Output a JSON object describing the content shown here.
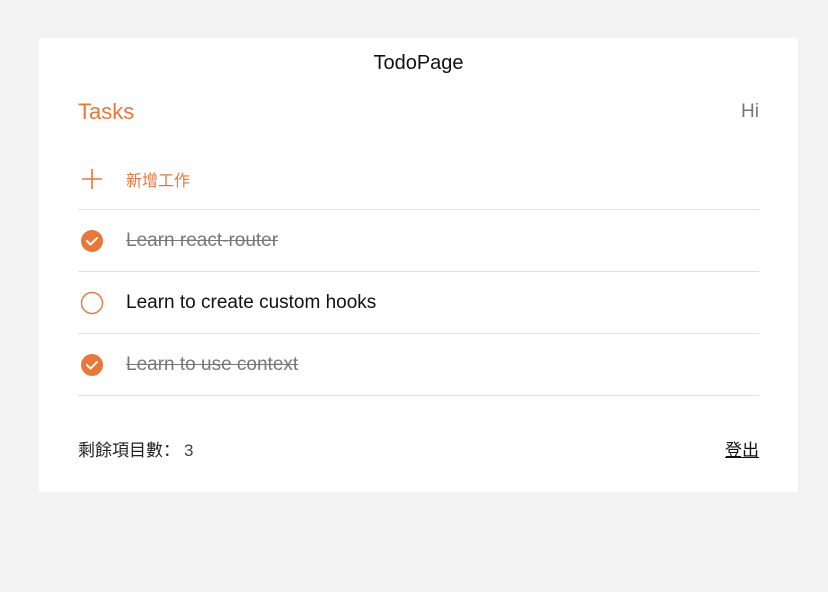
{
  "page": {
    "title": "TodoPage"
  },
  "header": {
    "heading": "Tasks",
    "greeting": "Hi"
  },
  "add_task": {
    "label": "新增工作",
    "icon": "plus-icon"
  },
  "todos": [
    {
      "text": "Learn react-router",
      "completed": true
    },
    {
      "text": "Learn to create custom hooks",
      "completed": false
    },
    {
      "text": "Learn to use context",
      "completed": true
    }
  ],
  "footer": {
    "remaining_label": "剩餘項目數：",
    "remaining_count": "3",
    "logout_label": "登出"
  },
  "colors": {
    "accent": "#e8773a",
    "background": "#f3f3f3",
    "card": "#ffffff",
    "divider": "#e1e1e1"
  }
}
